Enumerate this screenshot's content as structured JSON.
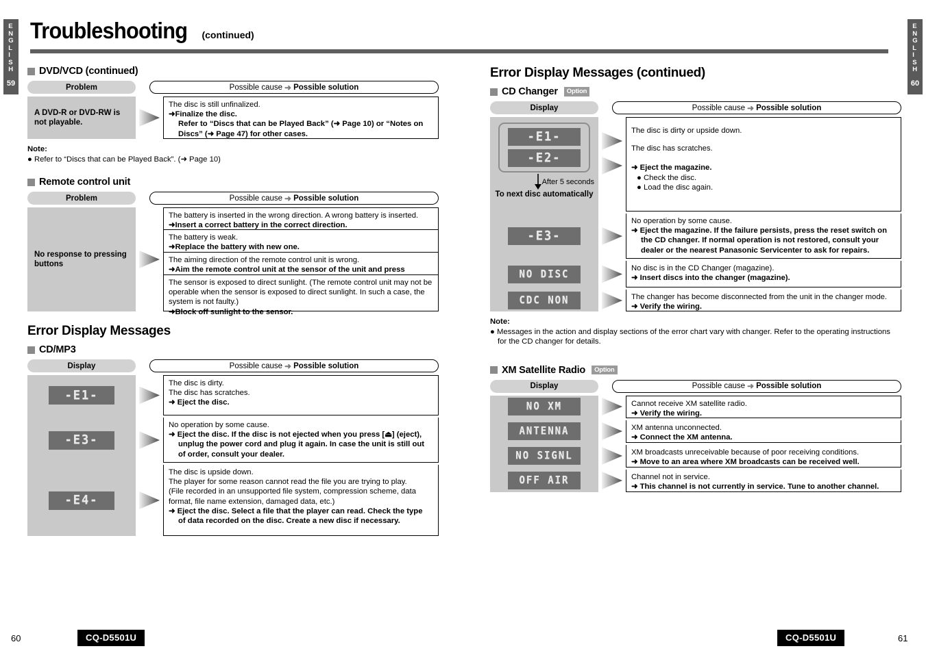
{
  "page": {
    "title_main": "Troubleshooting",
    "title_sub": "(continued)"
  },
  "tabs": {
    "left": {
      "letters": "ENGLISH",
      "page": "59"
    },
    "right": {
      "letters": "ENGLISH",
      "page": "60"
    }
  },
  "common": {
    "problem_label": "Problem",
    "display_label": "Display",
    "cause_prefix": "Possible cause",
    "cause_arrow": "➜",
    "cause_suffix": "Possible solution",
    "option_badge": "Option",
    "note_label": "Note:"
  },
  "left_column": {
    "dvd_vcd": {
      "heading": "DVD/VCD (continued)",
      "problem": "A DVD-R or DVD-RW is not playable.",
      "solution": {
        "cause": "The disc is still unfinalized.",
        "action": "Finalize the disc.",
        "action2": "Refer to “Discs that can be Played Back” (➜ Page 10) or “Notes on Discs” (➜ Page 47) for other cases."
      },
      "note": "Refer to “Discs that can be Played Back”. (➜ Page 10)"
    },
    "remote": {
      "heading": "Remote control unit",
      "problem": "No response to pressing buttons",
      "rows": [
        {
          "cause": "The battery is inserted in the wrong direction. A wrong battery is inserted.",
          "action": "Insert a correct battery in the correct direction."
        },
        {
          "cause": "The battery is weak.",
          "action": "Replace the battery with new one."
        },
        {
          "cause": "The aiming direction of the remote control unit is wrong.",
          "action": "Aim the remote control unit at the sensor of the unit and press buttons."
        },
        {
          "cause": "The sensor is exposed to direct sunlight. (The remote control unit may not be operable when the sensor is exposed to direct sunlight. In such a case, the system is not faulty.)",
          "action": "Block off sunlight to the sensor."
        }
      ]
    },
    "error_display": {
      "heading": "Error Display Messages",
      "sub_heading": "CD/MP3",
      "rows": [
        {
          "display": "-E1-",
          "lines": [
            "The disc is dirty.",
            "The disc has scratches."
          ],
          "action": "Eject the disc.",
          "action_cont": ""
        },
        {
          "display": "-E3-",
          "lines": [
            "No operation by some cause."
          ],
          "action": "Eject the disc. If the disc is not ejected when you press [⏏] (eject),",
          "action_cont": "unplug the power cord and plug it again. In case the unit is still out of order, consult your dealer."
        },
        {
          "display": "-E4-",
          "lines": [
            "The disc is upside down.",
            "The player for some reason cannot read the file you are trying to play.",
            "(File recorded in an unsupported file system, compression scheme, data format, file name extension, damaged data, etc.)"
          ],
          "action": "Eject the disc. Select a file that the player can read. Check the type",
          "action_cont": "of data recorded on the disc. Create a new disc if necessary."
        }
      ]
    }
  },
  "right_column": {
    "error_display": {
      "heading": "Error Display Messages (continued)",
      "cd_changer": {
        "sub_heading": "CD Changer",
        "group": {
          "displays": [
            "-E1-",
            "-E2-"
          ],
          "after_label": "After 5 seconds",
          "next_label": "To next disc automatically"
        },
        "group_solutions": {
          "line1": "The disc is dirty or upside down.",
          "line2": "The disc has scratches.",
          "action": "Eject the magazine.",
          "bullets": [
            "Check the disc.",
            "Load the disc again."
          ]
        },
        "rows": [
          {
            "display": "-E3-",
            "cause": "No operation by some cause.",
            "action": "Eject the magazine. If the failure persists, press the reset switch on",
            "action_cont": "the CD changer. If normal operation is not restored, consult your dealer or the nearest Panasonic Servicenter to ask for repairs."
          },
          {
            "display": "NO DISC",
            "cause": "No disc is in the CD Changer (magazine).",
            "action": "Insert discs into the changer (magazine).",
            "action_cont": ""
          },
          {
            "display": "CDC NON",
            "cause": "The changer has become disconnected from the unit in the changer mode.",
            "action": "Verify the wiring.",
            "action_cont": ""
          }
        ],
        "note": "Messages in the action and display sections of the error chart vary with changer. Refer to the operating instructions for the CD changer for details."
      },
      "xm_radio": {
        "sub_heading": "XM Satellite Radio",
        "rows": [
          {
            "display": "NO XM",
            "cause": "Cannot receive XM satellite radio.",
            "action": "Verify the wiring."
          },
          {
            "display": "ANTENNA",
            "cause": "XM antenna unconnected.",
            "action": "Connect the XM antenna."
          },
          {
            "display": "NO SIGNL",
            "cause": "XM broadcasts unreceivable because of poor receiving conditions.",
            "action": "Move to an area where XM broadcasts can be received well."
          },
          {
            "display": "OFF AIR",
            "cause": "Channel not in service.",
            "action": "This channel is not currently in service. Tune to another channel."
          }
        ]
      }
    }
  },
  "footer": {
    "left_page": "60",
    "right_page": "61",
    "model": "CQ-D5501U"
  },
  "colors": {
    "tab_bg": "#5a5a5a",
    "rule": "#5f5f5f",
    "cell_gray": "#c9c9c9",
    "pill_gray": "#d2d2d2",
    "lcd_bg": "#6e6e6e"
  }
}
